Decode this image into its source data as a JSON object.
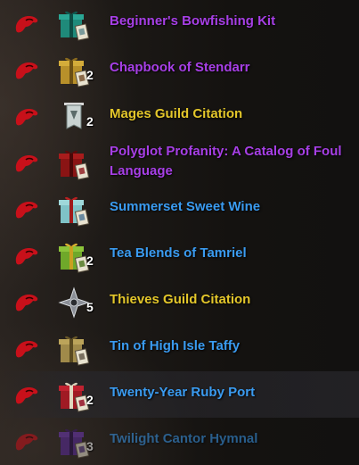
{
  "colors": {
    "stolen_icon": "#c8101a",
    "quality_epic": "#a73fe6",
    "quality_superior": "#3a9bf0",
    "quality_legendary": "#e3c62a",
    "quantity_text": "#ffffff"
  },
  "items": [
    {
      "name": "Beginner's Bowfishing Kit",
      "quantity": "",
      "quality": "purple",
      "icon": "teal-gift-box-icon",
      "stolen_icon": "stolen-hand-icon"
    },
    {
      "name": "Chapbook of Stendarr",
      "quantity": "2",
      "quality": "purple",
      "icon": "gold-gift-box-icon",
      "stolen_icon": "stolen-hand-icon"
    },
    {
      "name": "Mages Guild Citation",
      "quantity": "2",
      "quality": "gold",
      "icon": "guild-banner-icon",
      "stolen_icon": "stolen-hand-icon"
    },
    {
      "name_line1": "Polyglot Profanity: A Catalog of Foul",
      "name_line2": "Language",
      "quantity": "",
      "quality": "purple",
      "icon": "red-gift-box-icon",
      "stolen_icon": "stolen-hand-icon"
    },
    {
      "name": "Summerset Sweet Wine",
      "quantity": "",
      "quality": "blue",
      "icon": "cyan-gift-box-icon",
      "stolen_icon": "stolen-hand-icon"
    },
    {
      "name": "Tea Blends of Tamriel",
      "quantity": "2",
      "quality": "blue",
      "icon": "green-gift-box-icon",
      "stolen_icon": "stolen-hand-icon"
    },
    {
      "name": "Thieves Guild Citation",
      "quantity": "5",
      "quality": "gold",
      "icon": "thieves-guild-emblem-icon",
      "stolen_icon": "stolen-hand-icon"
    },
    {
      "name": "Tin of High Isle Taffy",
      "quantity": "",
      "quality": "blue",
      "icon": "tan-gift-box-icon",
      "stolen_icon": "stolen-hand-icon"
    },
    {
      "name": "Twenty-Year Ruby Port",
      "quantity": "2",
      "quality": "blue",
      "icon": "crimson-gift-box-icon",
      "stolen_icon": "stolen-hand-icon"
    },
    {
      "name": "Twilight Cantor Hymnal",
      "quantity": "3",
      "quality": "blue",
      "icon": "purple-gift-box-icon",
      "stolen_icon": "stolen-hand-icon"
    }
  ]
}
